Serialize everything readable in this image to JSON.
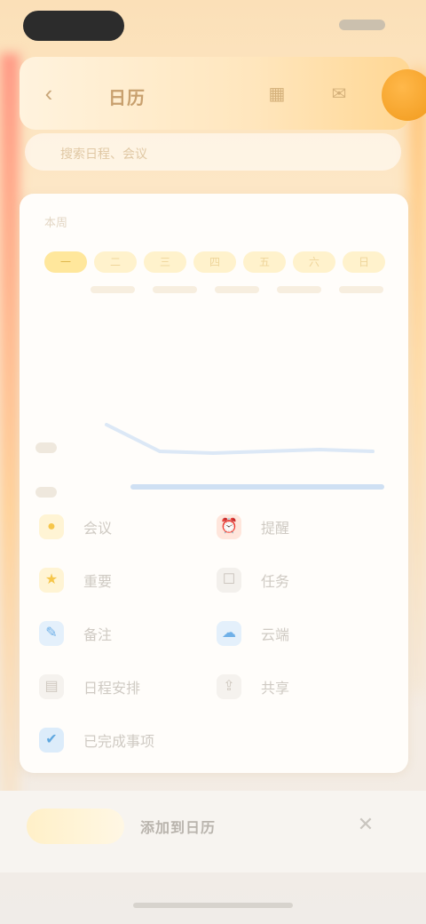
{
  "status_bar": {
    "time_pill_icon": "dynamic-island",
    "indicators_icon": "status-indicators"
  },
  "header": {
    "back_icon": "chevron-left-icon",
    "title": "日历",
    "icon_1": "calendar-icon",
    "icon_2": "mail-icon",
    "avatar_icon": "avatar"
  },
  "search": {
    "placeholder": "搜索日程、会议"
  },
  "card": {
    "label": "本周",
    "weekdays": [
      "一",
      "二",
      "三",
      "四",
      "五",
      "六",
      "日"
    ],
    "active_weekday_index": 0
  },
  "legend": [
    {
      "icon": "meeting-icon",
      "label": "会议",
      "color": "#f6c64a"
    },
    {
      "icon": "alarm-icon",
      "label": "提醒",
      "color": "#f08a5a"
    },
    {
      "icon": "star-icon",
      "label": "重要",
      "color": "#f6c64a"
    },
    {
      "icon": "task-icon",
      "label": "任务",
      "color": "#c8c2ba"
    },
    {
      "icon": "note-icon",
      "label": "备注",
      "color": "#6fb0e8"
    },
    {
      "icon": "cloud-icon",
      "label": "云端",
      "color": "#6fb0e8"
    },
    {
      "icon": "calendar-small-icon",
      "label": "日程安排",
      "color": "#cfc8bf"
    },
    {
      "icon": "share-icon",
      "label": "共享",
      "color": "#cfc8bf"
    },
    {
      "icon": "check-icon",
      "label": "已完成事项",
      "color": "#5fa8e0"
    }
  ],
  "colors": {
    "accent": "#f19a1c",
    "header_bg": "#ffe6bd",
    "card_bg": "#fffdfa"
  },
  "bottom_bar": {
    "center_label": "添加到日历",
    "close_icon": "close-icon"
  }
}
